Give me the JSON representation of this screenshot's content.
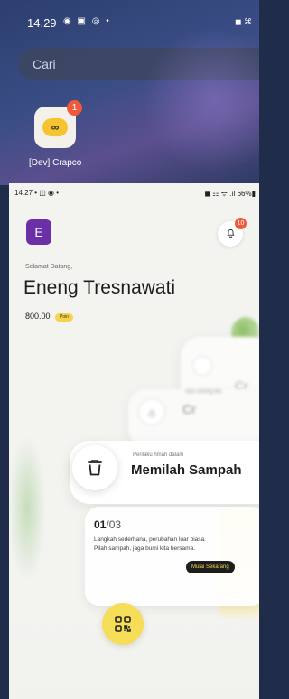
{
  "launcher": {
    "time": "14.29",
    "status_icons": "◉ ▣ ◎ •",
    "status_right": "◼ ⌘",
    "search_placeholder": "Cari",
    "app_label": "[Dev] Crapco",
    "app_badge": "1",
    "app_logo_text": "∞"
  },
  "app": {
    "status": {
      "time": "14.27 • ◫ ◉ •",
      "right": "◼ ☷ ᯤ .ıl 66%▮"
    },
    "avatar_letter": "E",
    "notification_count": "10",
    "greeting": "Selamat Datang,",
    "user_name": "Eneng Tresnawati",
    "points": "800.00",
    "points_unit": "Poin",
    "bg_card_1_text": "Cr",
    "bg_card_2_sub": "Aksi Sering Mu",
    "bg_card_2_title": "Cr",
    "card": {
      "subtitle": "Perilaku hmah dalam",
      "title": "Memilah Sampah"
    },
    "step": {
      "current": "01",
      "total": "/03"
    },
    "description": "Langkah sederhana, perubahan luar biasa. Pilah sampah, jaga bumi kita bersama.",
    "cta_label": "Mulai Sekarang"
  },
  "colors": {
    "accent_yellow": "#f6dd57",
    "avatar_purple": "#6b2fa7",
    "badge_red": "#f05a3b"
  },
  "icons": [
    "bell-icon",
    "trash-icon",
    "qr-code-icon",
    "bag-icon",
    "document-icon"
  ]
}
